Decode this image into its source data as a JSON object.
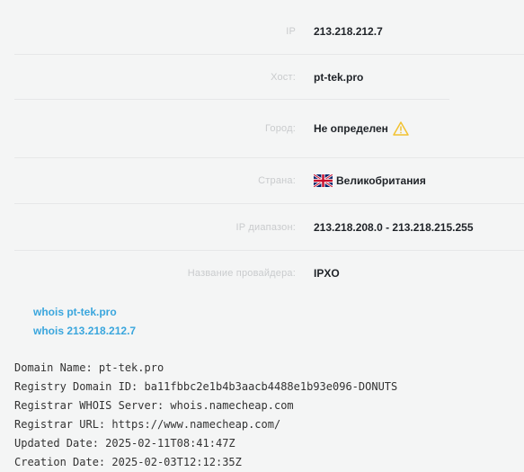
{
  "info": {
    "ip_label": "IP",
    "ip_value": "213.218.212.7",
    "host_label": "Хост:",
    "host_value": "pt-tek.pro",
    "city_label": "Город:",
    "city_value": "Не определен",
    "country_label": "Страна:",
    "country_value": "Великобритания",
    "range_label": "IP диапазон:",
    "range_value": "213.218.208.0 - 213.218.215.255",
    "provider_label": "Название провайдера:",
    "provider_value": "IPXO"
  },
  "icons": {
    "city_warning": "warning-icon",
    "country_flag": "uk-flag-icon"
  },
  "colors": {
    "link": "#3aa6dd",
    "label": "#c9cbcd",
    "warning": "#f2c230"
  },
  "links": {
    "whois_domain": "whois pt-tek.pro",
    "whois_ip": "whois 213.218.212.7"
  },
  "whois_lines": [
    "Domain Name: pt-tek.pro",
    "Registry Domain ID: ba11fbbc2e1b4b3aacb4488e1b93e096-DONUTS",
    "Registrar WHOIS Server: whois.namecheap.com",
    "Registrar URL: https://www.namecheap.com/",
    "Updated Date: 2025-02-11T08:41:47Z",
    "Creation Date: 2025-02-03T12:12:35Z"
  ]
}
